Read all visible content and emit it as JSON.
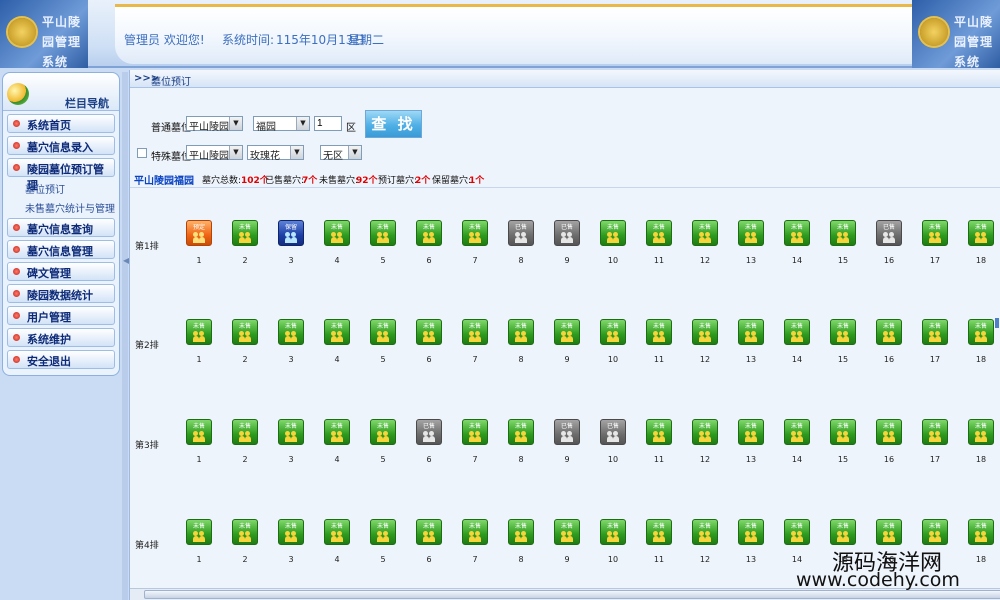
{
  "header": {
    "logo_text": "平山陵园管理系统",
    "welcome": "管理员 欢迎您!",
    "time_label": "系统时间:",
    "time_value": "115年10月13日",
    "weekday": "星期二"
  },
  "sidebar": {
    "title": "栏目导航",
    "items": [
      {
        "label": "系统首页"
      },
      {
        "label": "墓穴信息录入"
      },
      {
        "label": "陵园墓位预订管理"
      },
      {
        "label": "墓穴信息查询"
      },
      {
        "label": "墓穴信息管理"
      },
      {
        "label": "碑文管理"
      },
      {
        "label": "陵园数据统计"
      },
      {
        "label": "用户管理"
      },
      {
        "label": "系统维护"
      },
      {
        "label": "安全退出"
      }
    ],
    "sub_items": [
      {
        "label": "墓位预订"
      },
      {
        "label": "未售墓穴统计与管理"
      }
    ]
  },
  "breadcrumb": {
    "arrows": ">>>",
    "text": "墓位预订"
  },
  "filters": {
    "normal_label": "普通墓位",
    "normal_cemetery": "平山陵园",
    "normal_garden": "福园",
    "normal_zone_number": "1",
    "zone_suffix": "区",
    "search_label": "查 找",
    "special_label": "特殊墓位",
    "special_cemetery": "平山陵园",
    "special_garden": "玫瑰花",
    "special_zone": "无区"
  },
  "summary": {
    "area_title": "平山陵园福园",
    "total_label": "墓穴总数:",
    "total": "102个",
    "sold_label": "已售墓穴:",
    "sold": "7个",
    "unsold_label": "未售墓穴:",
    "unsold": "92个",
    "reserved_label": "预订墓穴:",
    "reserved": "2个",
    "kept_label": "保留墓穴:",
    "kept": "1个"
  },
  "status_labels": {
    "avail": "未售",
    "sold": "已售",
    "reserved": "预定",
    "kept": "保留"
  },
  "rows": [
    {
      "label": "第1排",
      "plots": [
        "reserved",
        "avail",
        "kept",
        "avail",
        "avail",
        "avail",
        "avail",
        "sold",
        "sold",
        "avail",
        "avail",
        "avail",
        "avail",
        "avail",
        "avail",
        "sold",
        "avail",
        "avail"
      ]
    },
    {
      "label": "第2排",
      "plots": [
        "avail",
        "avail",
        "avail",
        "avail",
        "avail",
        "avail",
        "avail",
        "avail",
        "avail",
        "avail",
        "avail",
        "avail",
        "avail",
        "avail",
        "avail",
        "avail",
        "avail",
        "avail"
      ]
    },
    {
      "label": "第3排",
      "plots": [
        "avail",
        "avail",
        "avail",
        "avail",
        "avail",
        "sold",
        "avail",
        "avail",
        "sold",
        "sold",
        "avail",
        "avail",
        "avail",
        "avail",
        "avail",
        "avail",
        "avail",
        "avail"
      ]
    },
    {
      "label": "第4排",
      "plots": [
        "avail",
        "avail",
        "avail",
        "avail",
        "avail",
        "avail",
        "avail",
        "avail",
        "avail",
        "avail",
        "avail",
        "avail",
        "avail",
        "avail",
        "avail",
        "avail",
        "avail",
        "avail"
      ]
    }
  ],
  "watermark": {
    "line1": "源码海洋网",
    "line2": "www.codehy.com"
  }
}
